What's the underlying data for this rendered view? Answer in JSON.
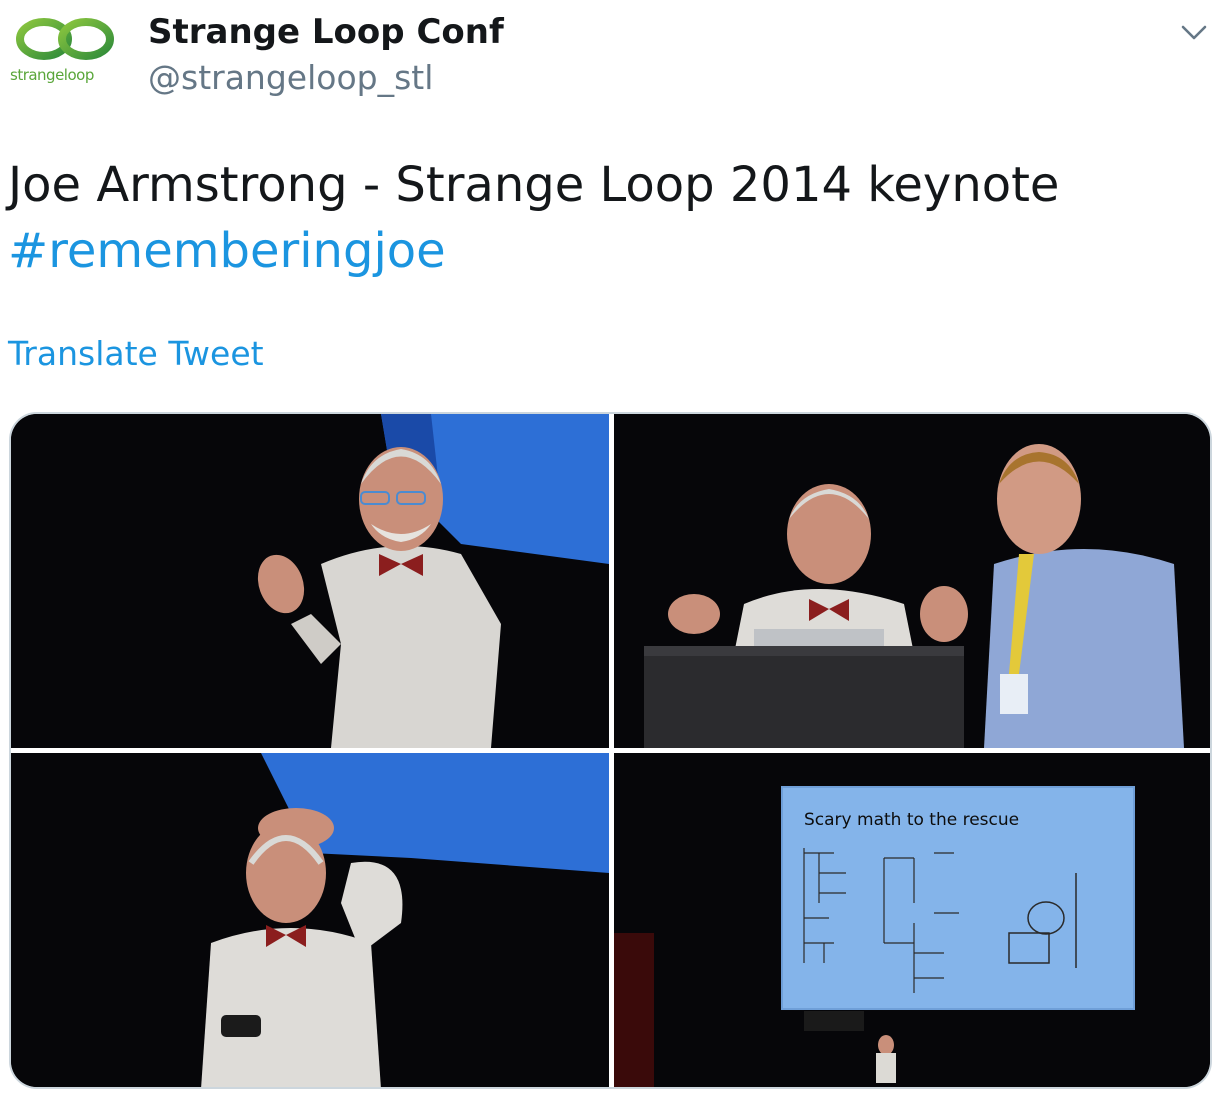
{
  "account": {
    "display_name": "Strange Loop Conf",
    "handle": "@strangeloop_stl",
    "avatar_text": "strangeloop"
  },
  "tweet": {
    "text": "Joe Armstrong - Strange Loop 2014 keynote",
    "hashtag": "#rememberingjoe",
    "translate_label": "Translate Tweet"
  },
  "photos": [
    {
      "name": "photo-1"
    },
    {
      "name": "photo-2"
    },
    {
      "name": "photo-3"
    },
    {
      "name": "photo-4",
      "slide_title": "Scary math to the rescue"
    }
  ],
  "icons": {
    "menu": "chevron-down-icon",
    "avatar": "strangeloop-logo"
  },
  "colors": {
    "link": "#1b95e0",
    "handle": "#657786",
    "text": "#14171a",
    "border": "#ccd6dd",
    "logo_green": "#5aa63a"
  }
}
